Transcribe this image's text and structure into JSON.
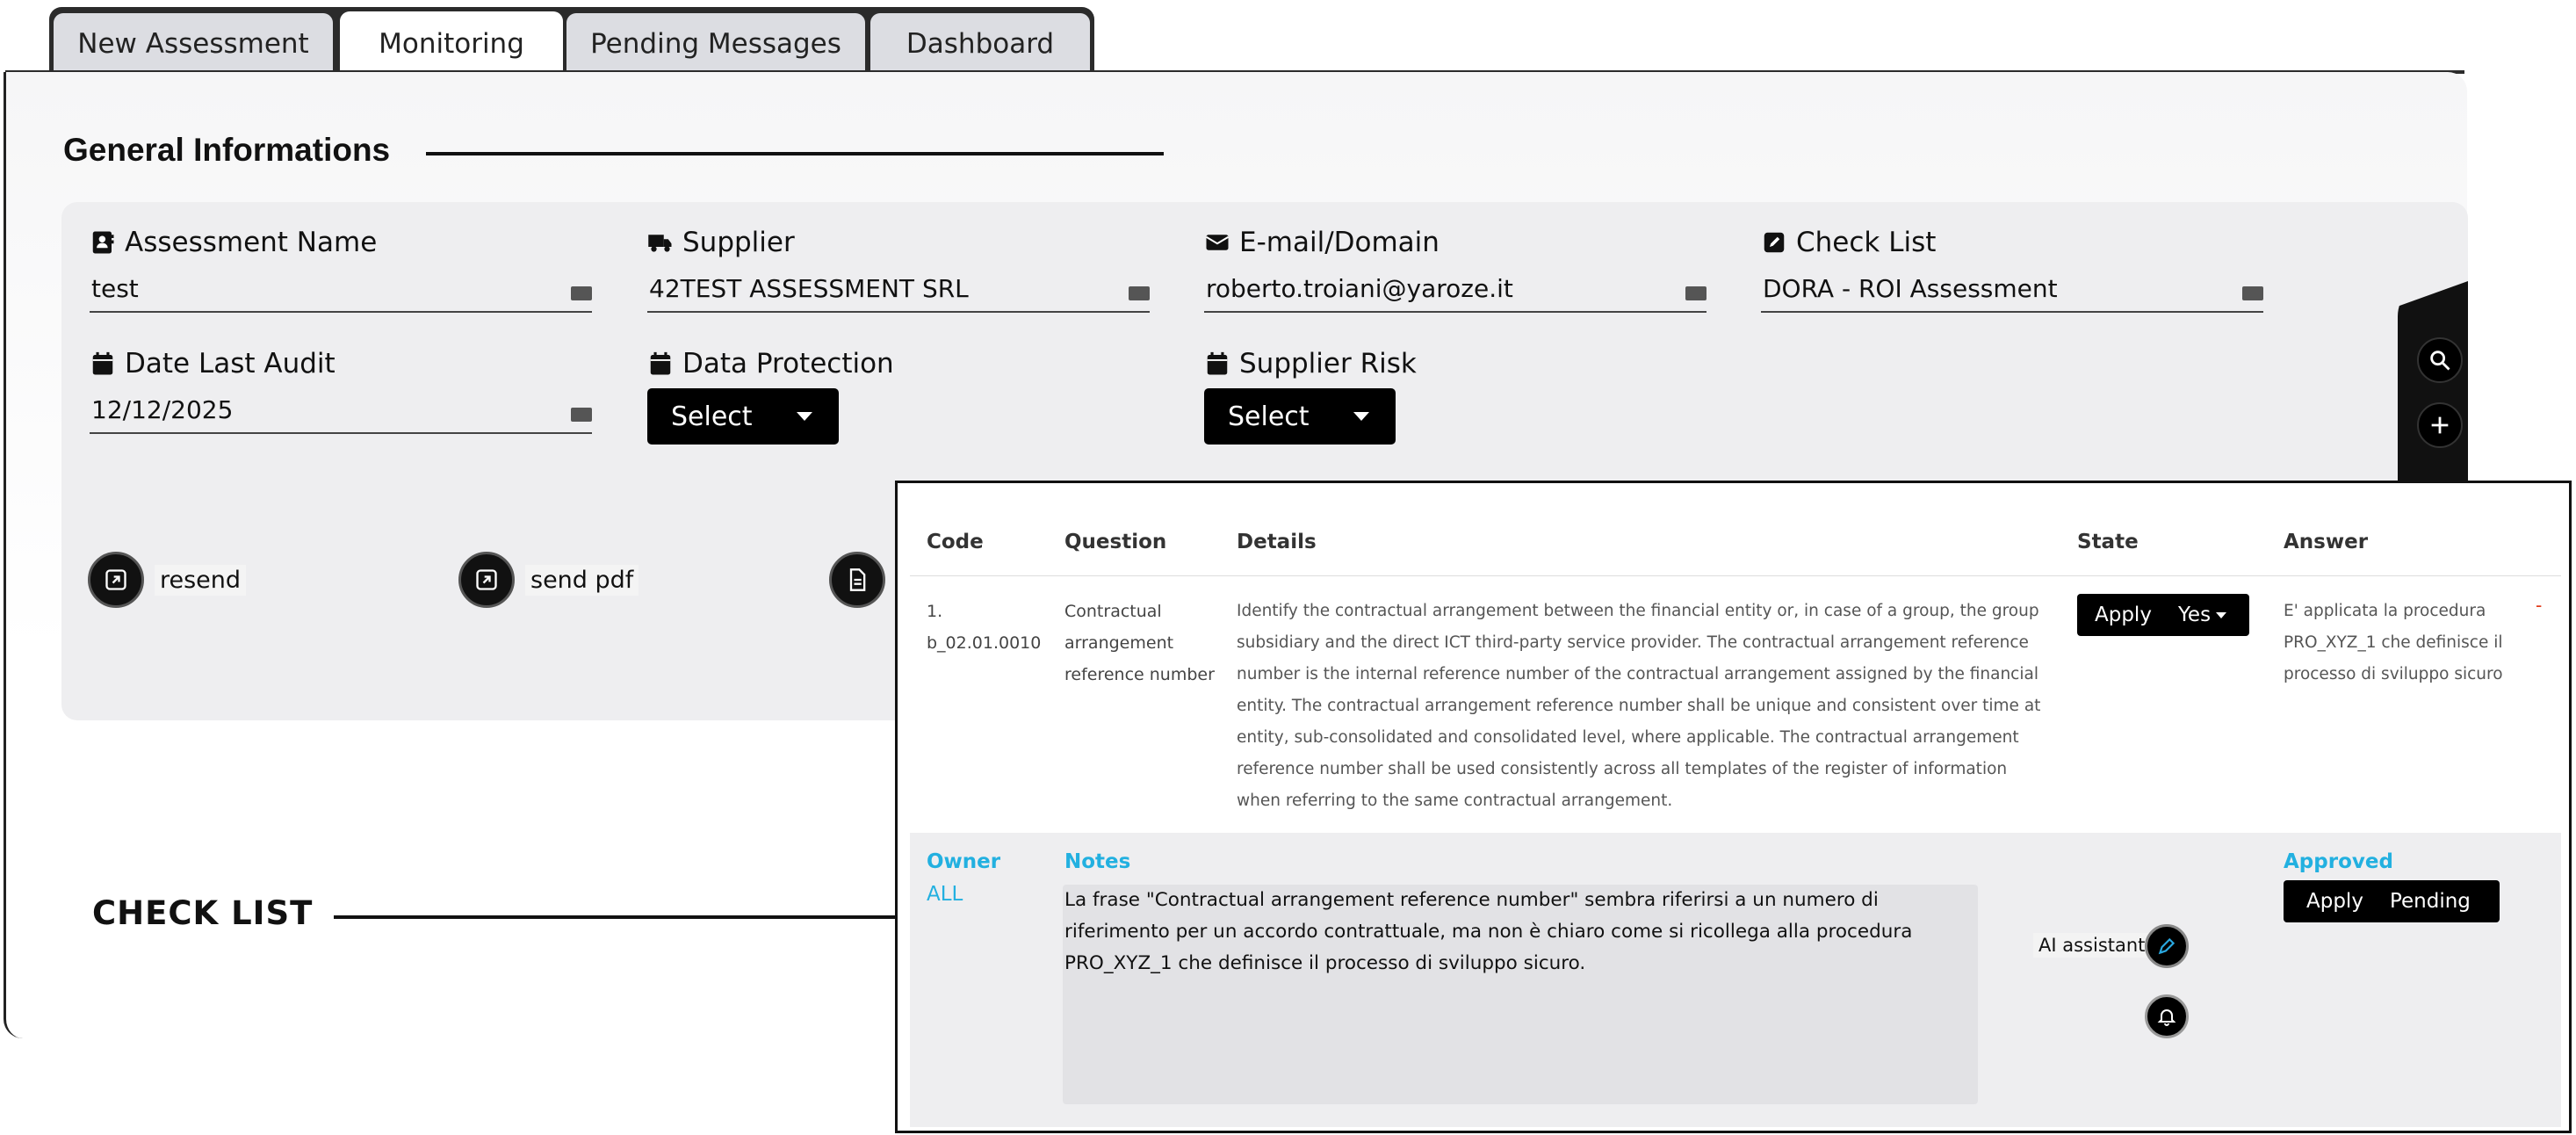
{
  "tabs": [
    {
      "label": "New Assessment"
    },
    {
      "label": "Monitoring"
    },
    {
      "label": "Pending Messages"
    },
    {
      "label": "Dashboard"
    }
  ],
  "active_tab": "Monitoring",
  "general": {
    "title": "General Informations",
    "fields": {
      "assessment_name": {
        "label": "Assessment Name",
        "value": "test",
        "icon": "contact-card-icon"
      },
      "supplier": {
        "label": "Supplier",
        "value": "42TEST ASSESSMENT SRL",
        "icon": "truck-icon"
      },
      "email": {
        "label": "E-mail/Domain",
        "value": "roberto.troiani@yaroze.it",
        "icon": "envelope-icon"
      },
      "checklist": {
        "label": "Check List",
        "value": "DORA - ROI Assessment",
        "icon": "edit-icon"
      },
      "date_last_audit": {
        "label": "Date Last Audit",
        "value": "12/12/2025",
        "icon": "calendar-icon"
      },
      "data_protection": {
        "label": "Data Protection",
        "select": "Select",
        "icon": "calendar-icon"
      },
      "supplier_risk": {
        "label": "Supplier Risk",
        "select": "Select",
        "icon": "calendar-icon"
      }
    },
    "actions": {
      "resend": "resend",
      "send_pdf": "send pdf"
    }
  },
  "checklist_title": "CHECK LIST",
  "table": {
    "headers": {
      "code": "Code",
      "question": "Question",
      "details": "Details",
      "state": "State",
      "answer": "Answer"
    },
    "row": {
      "code_line1": "1.",
      "code_line2": "b_02.01.0010",
      "question": "Contractual arrangement reference number",
      "details": "Identify the contractual arrangement between the financial entity or, in case of a group, the group subsidiary and the direct ICT third-party service provider. The contractual arrangement reference number is the internal reference number of the contractual arrangement assigned by the financial entity. The contractual arrangement reference number shall be unique and consistent over time at entity, sub-consolidated and consolidated level, where applicable. The contractual arrangement reference number shall be used consistently across all templates of the register of information when referring to the same contractual arrangement.",
      "state_apply": "Apply",
      "state_value": "Yes",
      "answer": "E' applicata la procedura PRO_XYZ_1 che definisce il processo di sviluppo sicuro",
      "dash": "-"
    },
    "sub": {
      "owner_label": "Owner",
      "owner_value": "ALL",
      "notes_label": "Notes",
      "notes_text": "La frase \"Contractual arrangement reference number\" sembra riferirsi a un numero di riferimento per un accordo contrattuale, ma non è chiaro come si ricollega alla procedura PRO_XYZ_1 che definisce il processo di sviluppo sicuro.",
      "ai_assistant": "AI assistant",
      "approved_label": "Approved",
      "approved_apply": "Apply",
      "approved_value": "Pending"
    }
  }
}
